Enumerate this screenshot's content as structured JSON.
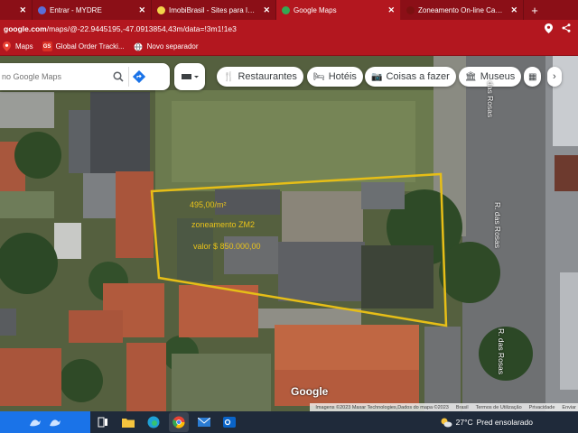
{
  "tabs": [
    {
      "title": "",
      "favicon_color": "#5f6368",
      "close": "✕"
    },
    {
      "title": "Entrar - MYDRE",
      "favicon_color": "#5b6ed8",
      "close": "✕"
    },
    {
      "title": "ImobiBrasil - Sites para Imob",
      "favicon_color": "#f3d34a",
      "close": "✕"
    },
    {
      "title": "Google Maps",
      "favicon_color": "#34a853",
      "close": "✕",
      "active": true
    },
    {
      "title": "Zoneamento On-line Camp",
      "favicon_color": "#7a1010",
      "close": "✕"
    }
  ],
  "new_tab": "+",
  "address": {
    "domain": "google.com",
    "path": "/maps/@-22.9445195,-47.0913854,43m/data=!3m1!1e3"
  },
  "bookmarks": [
    {
      "label": "Maps",
      "icon": "maps-icon",
      "color": "#ea4335",
      "glyph": ""
    },
    {
      "label": "Global Order Tracki...",
      "icon": "gos-icon",
      "color": "#d93025",
      "glyph": "GS"
    },
    {
      "label": "Novo separador",
      "icon": "globe-icon",
      "color": "#5f6368",
      "glyph": ""
    }
  ],
  "search": {
    "placeholder": "no Google Maps"
  },
  "chips": [
    {
      "label": "Restaurantes",
      "icon": "fork-knife-icon"
    },
    {
      "label": "Hotéis",
      "icon": "bed-icon"
    },
    {
      "label": "Coisas a fazer",
      "icon": "camera-icon"
    },
    {
      "label": "Museus",
      "icon": "museum-icon"
    }
  ],
  "overlay": {
    "price_m2": "495,00/m²",
    "zone": "zoneamento ZM2",
    "value": "valor $ 850.000,00",
    "color": "#e8c21a"
  },
  "streets": [
    "das Rosas",
    "R. das Rosas",
    "R. das Rosas"
  ],
  "google_logo": "Google",
  "attribution": [
    "Imagens ©2023 Maxar Technologies,Dados do mapa ©2023",
    "Brasil",
    "Termos de Utilização",
    "Privacidade",
    "Enviar"
  ],
  "taskbar": {
    "apps": [
      "task-view-icon",
      "file-explorer-icon",
      "edge-icon",
      "chrome-icon",
      "mail-icon",
      "outlook-icon"
    ],
    "weather": {
      "temp": "27°C",
      "desc": "Pred ensolarado"
    }
  }
}
